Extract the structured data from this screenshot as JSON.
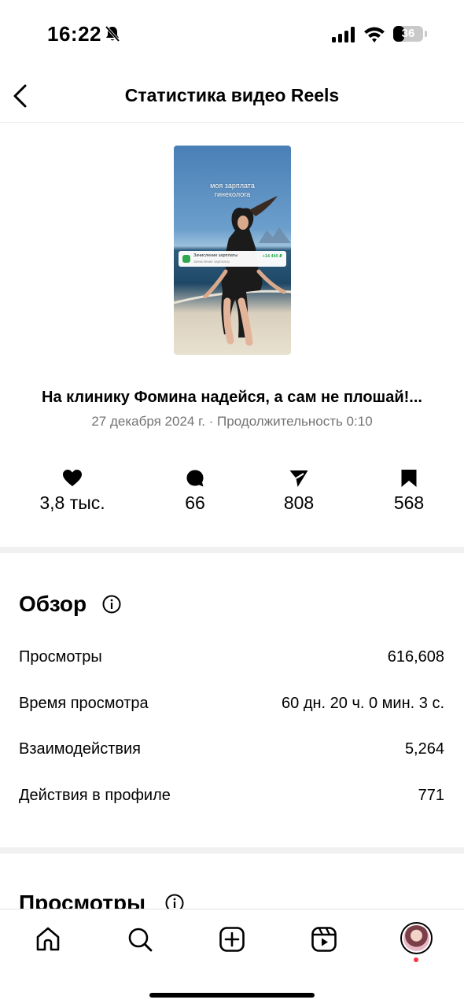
{
  "status_bar": {
    "time": "16:22",
    "battery_level": "36",
    "battery_fraction": 0.36
  },
  "header": {
    "title": "Статистика видео Reels"
  },
  "reel": {
    "thumbnail_caption": "моя зарплата\nгинеколога",
    "notification_title": "Зачисление зарплаты",
    "notification_subtitle": "Зачисление зарплаты",
    "notification_amount": "+14 440 ₽",
    "title": "На клинику Фомина надейся, а сам не плошай!...",
    "meta": "27 декабря 2024 г. · Продолжительность 0:10"
  },
  "engagement": {
    "likes": "3,8 тыс.",
    "comments": "66",
    "shares": "808",
    "saves": "568"
  },
  "overview": {
    "heading": "Обзор",
    "rows": [
      {
        "label": "Просмотры",
        "value": "616,608"
      },
      {
        "label": "Время просмотра",
        "value": "60 дн. 20 ч. 0 мин. 3 с."
      },
      {
        "label": "Взаимодействия",
        "value": "5,264"
      },
      {
        "label": "Действия в профиле",
        "value": "771"
      }
    ]
  },
  "views_section": {
    "heading": "Просмотры"
  },
  "tab_bar": {
    "items": [
      "home-icon",
      "search-icon",
      "create-icon",
      "reels-icon",
      "profile-avatar"
    ]
  }
}
